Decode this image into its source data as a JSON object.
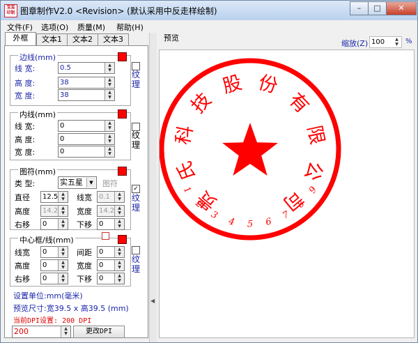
{
  "window": {
    "title": "图章制作V2.0 <Revision> (默认采用中反走样绘制)",
    "icon_text": [
      "宝玺",
      "印制"
    ],
    "buttons": {
      "minimize": "–",
      "maximize": "□",
      "close": "✕"
    }
  },
  "menu": [
    "文件(F)",
    "选项(O)",
    "质量(M)",
    "帮助(H)"
  ],
  "tabs": [
    {
      "label": "外框",
      "active": true
    },
    {
      "label": "文本1",
      "active": false
    },
    {
      "label": "文本2",
      "active": false
    },
    {
      "label": "文本3",
      "active": false
    }
  ],
  "border_line": {
    "title": "边线(mm)",
    "color": "#ff0000",
    "width_label": "线  宽:",
    "width_value": "0.5",
    "height_label": "高  度:",
    "height_value": "38",
    "breadth_label": "宽  度:",
    "breadth_value": "38",
    "texture_label": "纹理",
    "texture_checked": false
  },
  "inner_line": {
    "title": "内线(mm)",
    "color": "#ff0000",
    "width_label": "线  宽:",
    "width_value": "0",
    "height_label": "高  度:",
    "height_value": "0",
    "breadth_label": "宽  度:",
    "breadth_value": "0",
    "texture_label": "纹理",
    "texture_checked": false
  },
  "symbol": {
    "title": "图符(mm)",
    "color": "#ff0000",
    "type_label": "类  型:",
    "type_value": "实五星",
    "symbol_button": "图符",
    "diameter_label": "直径",
    "diameter_value": "12.5",
    "linewidth_label": "线宽",
    "linewidth_value": "0.1",
    "height_label": "高度",
    "height_value": "14.2",
    "width_label": "宽度",
    "width_value": "14.2",
    "right_label": "右移",
    "right_value": "0",
    "down_label": "下移",
    "down_value": "0",
    "texture_label": "纹理",
    "texture_checked": true
  },
  "center_frame": {
    "title": "中心框/线(mm)",
    "color": "#ff0000",
    "linewidth_label": "线宽",
    "linewidth_value": "0",
    "gap_label": "间距",
    "gap_value": "0",
    "height_label": "高度",
    "height_value": "0",
    "width_label": "宽度",
    "width_value": "0",
    "right_label": "右移",
    "right_value": "0",
    "down_label": "下移",
    "down_value": "0",
    "texture_label": "纹理",
    "texture_checked": false
  },
  "info": {
    "unit": "设置单位:mm(毫米)",
    "preview_size": "预览尺寸:宽39.5 x 高39.5 (mm)",
    "dpi_current": "当前DPI设置: 200 DPI",
    "dpi_value": "200",
    "change_dpi": "更改DPI"
  },
  "preview": {
    "label": "预览",
    "zoom_label": "缩放(Z)",
    "zoom_value": "100",
    "zoom_unit": "%"
  },
  "seal": {
    "color": "#ff0000",
    "arc_text": "贵氏科技股份有限公司",
    "bottom_digits": "123456789"
  }
}
